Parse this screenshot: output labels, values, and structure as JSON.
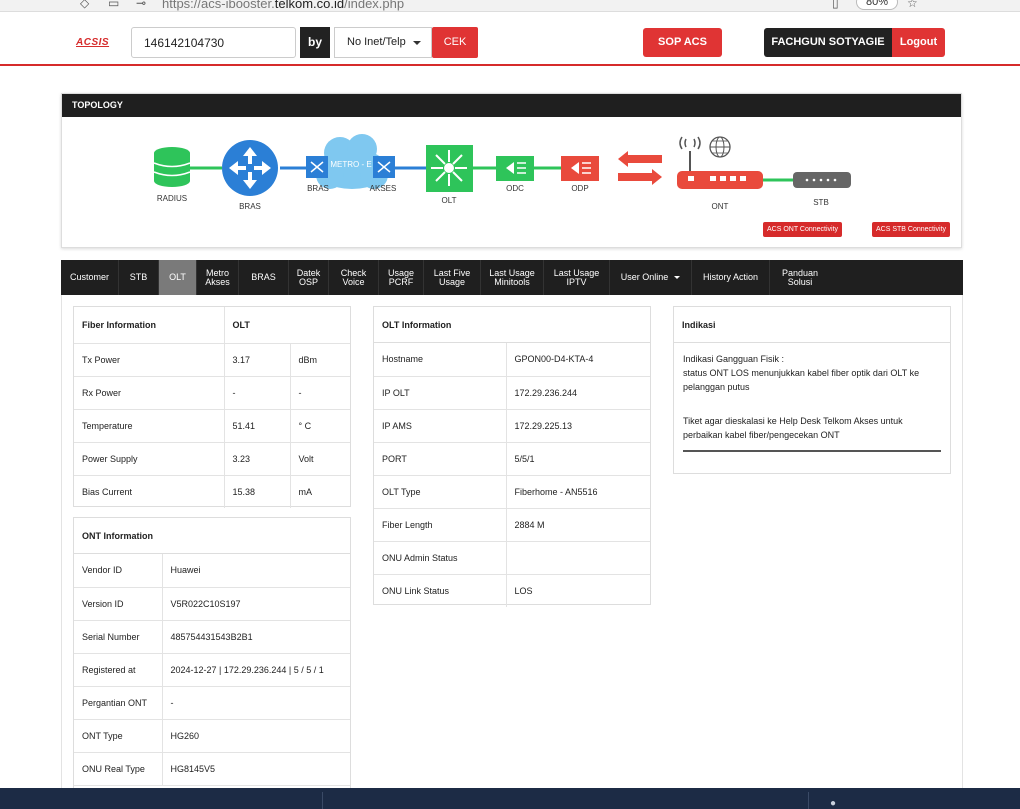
{
  "browser": {
    "url_prefix": "https://acs-ibooster.",
    "url_domain": "telkom.co.id",
    "url_path": "/index.php",
    "zoom": "80%"
  },
  "header": {
    "logo": "ACSIS",
    "search_value": "146142104730",
    "by_label": "by",
    "select_value": "No Inet/Telp",
    "cek_label": "CEK",
    "sop_label": "SOP ACS",
    "user_name": "FACHGUN SOTYAGIE",
    "logout_label": "Logout"
  },
  "topology": {
    "title": "TOPOLOGY",
    "nodes": {
      "radius": "RADIUS",
      "bras": "BRAS",
      "bras2": "BRAS",
      "metro": "METRO - E",
      "akses": "AKSES",
      "olt": "OLT",
      "odc": "ODC",
      "odp": "ODP",
      "ont": "ONT",
      "stb": "STB"
    },
    "acs_ont_label": "ACS ONT Connectivity",
    "acs_stb_label": "ACS STB Connectivity"
  },
  "nav": {
    "tabs": [
      {
        "l1": "Customer",
        "l2": ""
      },
      {
        "l1": "STB",
        "l2": ""
      },
      {
        "l1": "OLT",
        "l2": ""
      },
      {
        "l1": "Metro",
        "l2": "Akses"
      },
      {
        "l1": "BRAS",
        "l2": ""
      },
      {
        "l1": "Datek",
        "l2": "OSP"
      },
      {
        "l1": "Check",
        "l2": "Voice"
      },
      {
        "l1": "Usage",
        "l2": "PCRF"
      },
      {
        "l1": "Last Five",
        "l2": "Usage"
      },
      {
        "l1": "Last Usage",
        "l2": "Minitools"
      },
      {
        "l1": "Last Usage",
        "l2": "IPTV"
      },
      {
        "l1": "User Online",
        "l2": ""
      },
      {
        "l1": "History Action",
        "l2": ""
      },
      {
        "l1": "Panduan",
        "l2": "Solusi"
      }
    ]
  },
  "fiber": {
    "head_left": "Fiber Information",
    "head_right": "OLT",
    "rows": [
      {
        "label": "Tx Power",
        "value": "3.17",
        "unit": "dBm"
      },
      {
        "label": "Rx Power",
        "value": "-",
        "unit": "-"
      },
      {
        "label": "Temperature",
        "value": "51.41",
        "unit": "° C"
      },
      {
        "label": "Power Supply",
        "value": "3.23",
        "unit": "Volt"
      },
      {
        "label": "Bias Current",
        "value": "15.38",
        "unit": "mA"
      }
    ]
  },
  "ont": {
    "head": "ONT Information",
    "rows": [
      {
        "label": "Vendor ID",
        "value": "Huawei"
      },
      {
        "label": "Version ID",
        "value": "V5R022C10S197"
      },
      {
        "label": "Serial Number",
        "value": "485754431543B2B1"
      },
      {
        "label": "Registered at",
        "value": "2024-12-27 | 172.29.236.244 | 5 / 5 / 1"
      },
      {
        "label": "Pergantian ONT",
        "value": "-"
      },
      {
        "label": "ONT Type",
        "value": "HG260"
      },
      {
        "label": "ONU Real Type",
        "value": "HG8145V5"
      }
    ]
  },
  "olt": {
    "head": "OLT Information",
    "rows": [
      {
        "label": "Hostname",
        "value": "GPON00-D4-KTA-4"
      },
      {
        "label": "IP OLT",
        "value": "172.29.236.244"
      },
      {
        "label": "IP AMS",
        "value": "172.29.225.13"
      },
      {
        "label": "PORT",
        "value": "5/5/1"
      },
      {
        "label": "OLT Type",
        "value": "Fiberhome - AN5516"
      },
      {
        "label": "Fiber Length",
        "value": "2884 M"
      },
      {
        "label": "ONU Admin Status",
        "value": ""
      },
      {
        "label": "ONU Link Status",
        "value": "LOS"
      }
    ]
  },
  "indikasi": {
    "head": "Indikasi",
    "line1": "Indikasi Gangguan Fisik :",
    "line2": "status ONT LOS menunjukkan kabel fiber optik dari OLT ke pelanggan putus",
    "line3": "Tiket agar dieskalasi ke Help Desk Telkom Akses untuk perbaikan kabel fiber/pengecekan ONT"
  },
  "colors": {
    "accent_red": "#e03434",
    "dark": "#1f1f1f",
    "green": "#2ec45a",
    "blue": "#2b7fd6"
  }
}
